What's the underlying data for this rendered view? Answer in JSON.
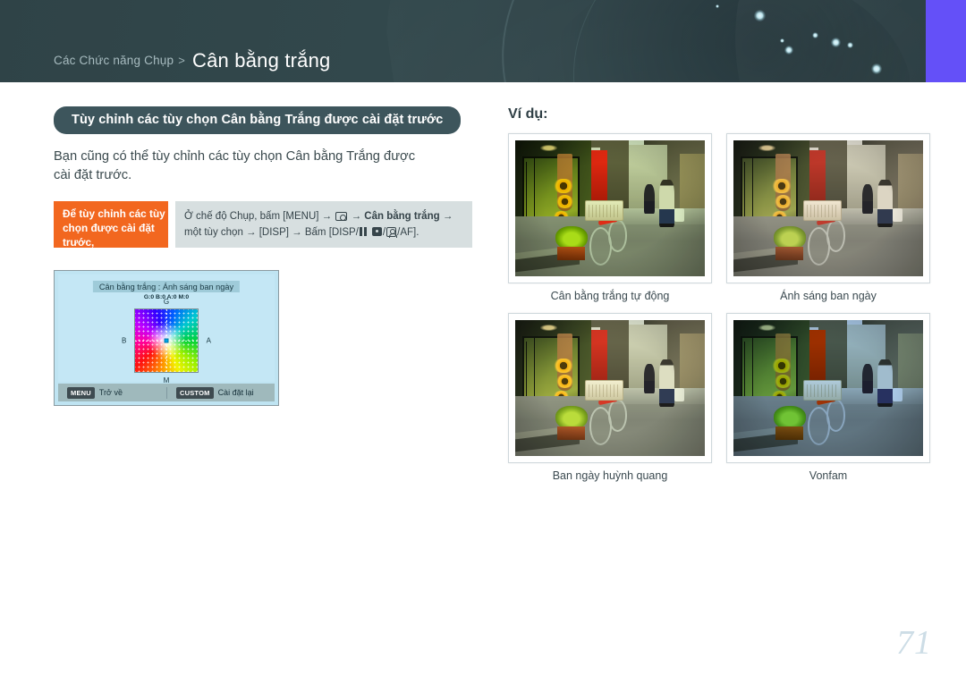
{
  "header": {
    "breadcrumb_parent": "Các Chức năng Chụp",
    "breadcrumb_separator": ">",
    "breadcrumb_current": "Cân bằng trắng",
    "accent_bar_color": "#6450f8",
    "banner_color": "#2f4347"
  },
  "left": {
    "section_pill": "Tùy chỉnh các tùy chọn Cân bằng Trắng được cài đặt trước",
    "body_text": "Bạn cũng có thể tùy chỉnh các tùy chọn Cân bằng Trắng được cài đặt trước.",
    "instruction": {
      "label": "Để tùy chỉnh các tùy chọn được cài đặt trước,",
      "label_color": "#f2671f",
      "line1_a": "Ở chế độ Chụp, bấm [MENU] →",
      "line1_icon": "camera-icon",
      "line1_b": "→",
      "line1_bold": "Cân bằng trắng",
      "line1_c": "→",
      "line2_a": "một tùy chọn → [DISP] → Bấm [DISP/",
      "line2_icon1": "grid-icon",
      "line2_icon2": "square-dot-icon",
      "line2_mid": "/",
      "line2_icon3": "person-icon",
      "line2_b": "/AF]."
    },
    "lcd": {
      "title": "Cân bằng trắng : Ánh sáng ban ngày",
      "values": "G:0 B:0 A:0 M:0",
      "axis_top": "G",
      "axis_bottom": "M",
      "axis_left": "B",
      "axis_right": "A",
      "footer_left_key": "MENU",
      "footer_left_text": "Trở về",
      "footer_right_key": "CUSTOM",
      "footer_right_text": "Cài đặt lại"
    }
  },
  "right": {
    "examples_title": "Ví dụ:",
    "examples": [
      {
        "caption": "Cân bằng trắng tự động",
        "wb_class": "wb-auto"
      },
      {
        "caption": "Ánh sáng ban ngày",
        "wb_class": "wb-day"
      },
      {
        "caption": "Ban ngày huỳnh quang",
        "wb_class": "wb-fluo"
      },
      {
        "caption": "Vonfam",
        "wb_class": "wb-tung"
      }
    ]
  },
  "footer": {
    "page_number": "71"
  }
}
